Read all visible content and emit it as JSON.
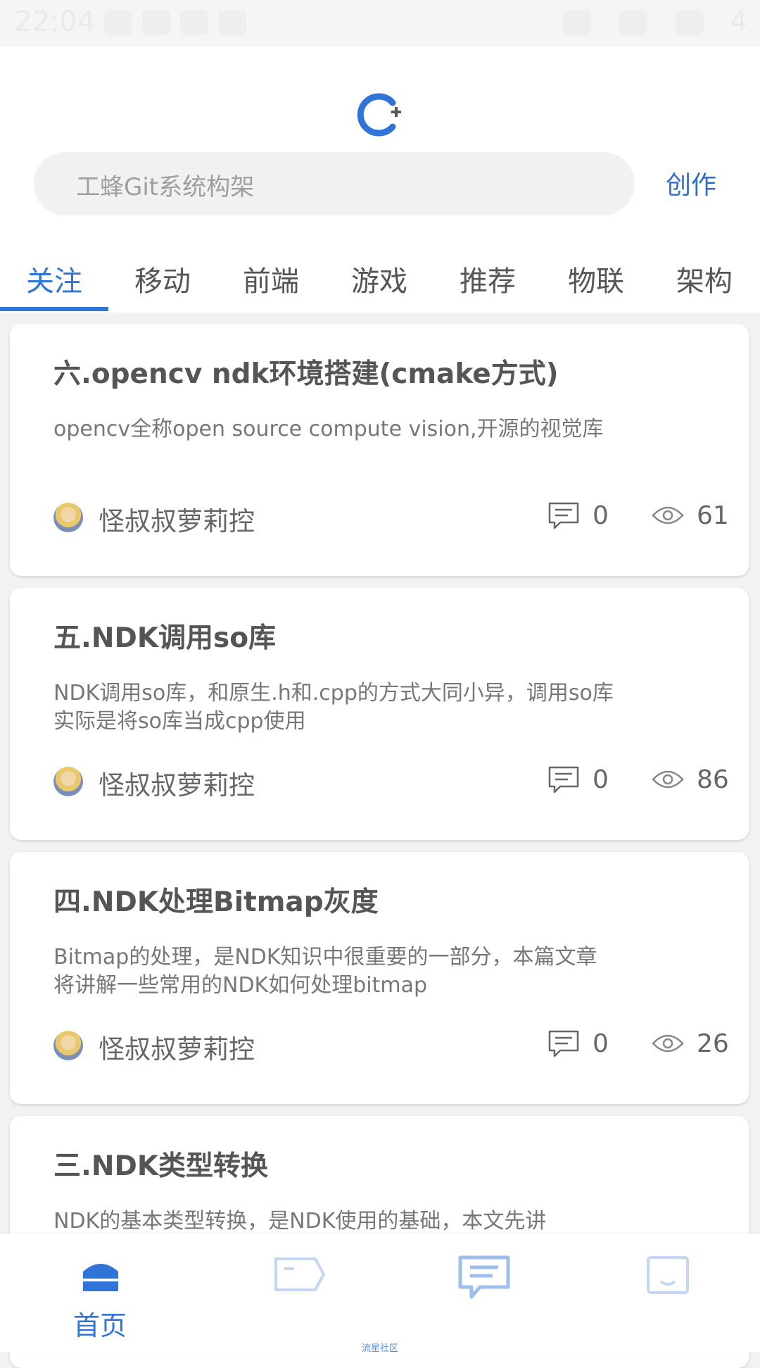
{
  "status_bar": {
    "time": "22:04",
    "battery": "4"
  },
  "header": {
    "search_placeholder": "工蜂Git系统构架",
    "create_label": "创作",
    "accent_color": "#2f74d6"
  },
  "tabs": [
    {
      "label": "关注"
    },
    {
      "label": "移动"
    },
    {
      "label": "前端"
    },
    {
      "label": "游戏"
    },
    {
      "label": "推荐"
    },
    {
      "label": "物联"
    },
    {
      "label": "架构"
    }
  ],
  "articles": [
    {
      "title": "六.opencv ndk环境搭建(cmake方式)",
      "summary": "opencv全称open source compute vision,开源的视觉库",
      "author": "怪叔叔萝莉控",
      "comments": "0",
      "views": "61"
    },
    {
      "title": "五.NDK调用so库",
      "summary": "NDK调用so库，和原生.h和.cpp的方式大同小异，调用so库实际是将so库当成cpp使用",
      "author": "怪叔叔萝莉控",
      "comments": "0",
      "views": "86"
    },
    {
      "title": "四.NDK处理Bitmap灰度",
      "summary": "Bitmap的处理，是NDK知识中很重要的一部分，本篇文章将讲解一些常用的NDK如何处理bitmap",
      "author": "怪叔叔萝莉控",
      "comments": "0",
      "views": "26"
    },
    {
      "title": "三.NDK类型转换",
      "summary": "NDK的基本类型转换，是NDK使用的基础，本文先讲"
    }
  ],
  "bottom_nav": {
    "home_label": "首页",
    "footer_mark": "流星社区"
  }
}
